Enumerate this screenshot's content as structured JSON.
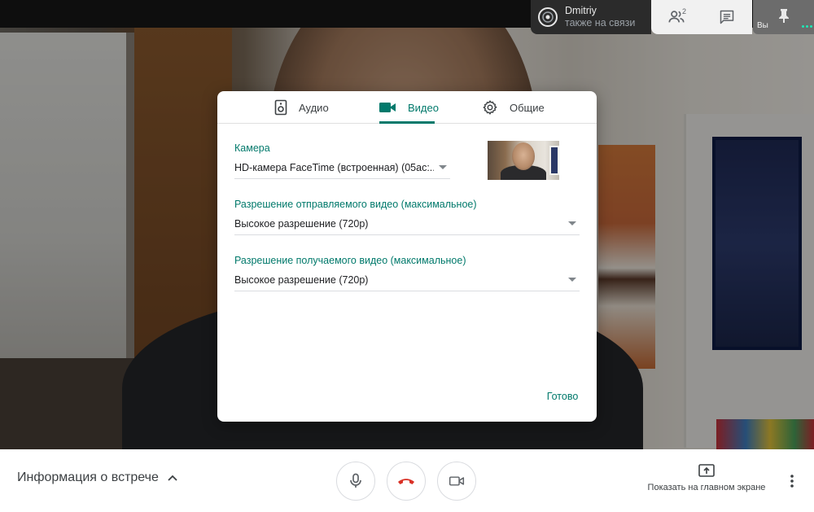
{
  "participant": {
    "name": "Dmitriy",
    "status": "также на связи"
  },
  "top_actions": {
    "people_count": "2"
  },
  "self_view": {
    "label": "Вы"
  },
  "dialog": {
    "tabs": [
      {
        "label": "Аудио",
        "icon": "speaker-icon",
        "selected": false
      },
      {
        "label": "Видео",
        "icon": "videocam-icon",
        "selected": true
      },
      {
        "label": "Общие",
        "icon": "gear-icon",
        "selected": false
      }
    ],
    "camera": {
      "label": "Камера",
      "value": "HD-камера FaceTime (встроенная) (05ac:..."
    },
    "send_resolution": {
      "label": "Разрешение отправляемого видео (максимальное)",
      "value": "Высокое разрешение (720p)"
    },
    "receive_resolution": {
      "label": "Разрешение получаемого видео (максимальное)",
      "value": "Высокое разрешение (720p)"
    },
    "done_label": "Готово"
  },
  "bottom_bar": {
    "meeting_info": "Информация о встрече",
    "present_label": "Показать на главном экране"
  },
  "colors": {
    "accent": "#00796b",
    "hangup": "#d93025"
  }
}
